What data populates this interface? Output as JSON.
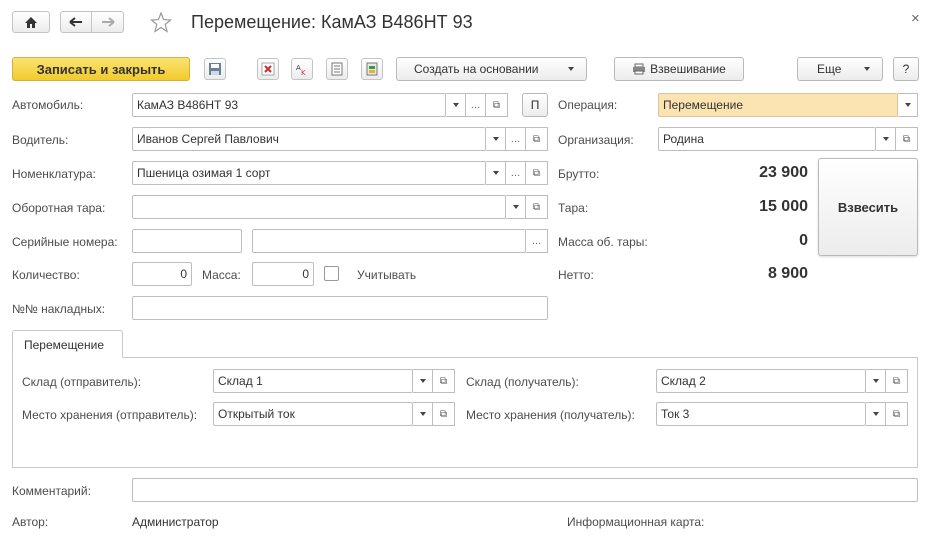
{
  "header": {
    "title": "Перемещение: КамАЗ В486НТ 93",
    "close_glyph": "×"
  },
  "toolbar": {
    "save_close_label": "Записать и закрыть",
    "create_based_label": "Создать на основании",
    "weighing_label": "Взвешивание",
    "more_label": "Еще",
    "help_label": "?"
  },
  "form": {
    "car": {
      "label": "Автомобиль:",
      "value": "КамАЗ В486НТ 93",
      "p_label": "П"
    },
    "driver": {
      "label": "Водитель:",
      "value": "Иванов Сергей Павлович"
    },
    "nomenclature": {
      "label": "Номенклатура:",
      "value": "Пшеница озимая 1 сорт"
    },
    "container": {
      "label": "Оборотная тара:",
      "value": ""
    },
    "serial": {
      "label": "Серийные номера:",
      "value1": "",
      "value2": ""
    },
    "quantity": {
      "label": "Количество:",
      "value": "0"
    },
    "mass": {
      "label": "Масса:",
      "value": "0"
    },
    "consider": {
      "label": "Учитывать",
      "checked": false
    },
    "invoices": {
      "label": "№№ накладных:",
      "value": ""
    },
    "operation": {
      "label": "Операция:",
      "value": "Перемещение"
    },
    "organization": {
      "label": "Организация:",
      "value": "Родина"
    },
    "gross": {
      "label": "Брутто:",
      "value": "23 900"
    },
    "tare": {
      "label": "Тара:",
      "value": "15 000"
    },
    "container_mass": {
      "label": "Масса об. тары:",
      "value": "0"
    },
    "net": {
      "label": "Нетто:",
      "value": "8 900"
    },
    "weigh_button": "Взвесить"
  },
  "tab": {
    "label": "Перемещение",
    "warehouse_from": {
      "label": "Склад (отправитель):",
      "value": "Склад 1"
    },
    "warehouse_to": {
      "label": "Склад (получатель):",
      "value": "Склад 2"
    },
    "storage_from": {
      "label": "Место хранения (отправитель):",
      "value": "Открытый ток"
    },
    "storage_to": {
      "label": "Место хранения (получатель):",
      "value": "Ток 3"
    }
  },
  "footer": {
    "comment_label": "Комментарий:",
    "comment_value": "",
    "author_label": "Автор:",
    "author_value": "Администратор",
    "info_card_label": "Информационная карта:"
  },
  "colors": {
    "primary_button": "#f5d44a",
    "operation_field": "#fbe4b1"
  }
}
